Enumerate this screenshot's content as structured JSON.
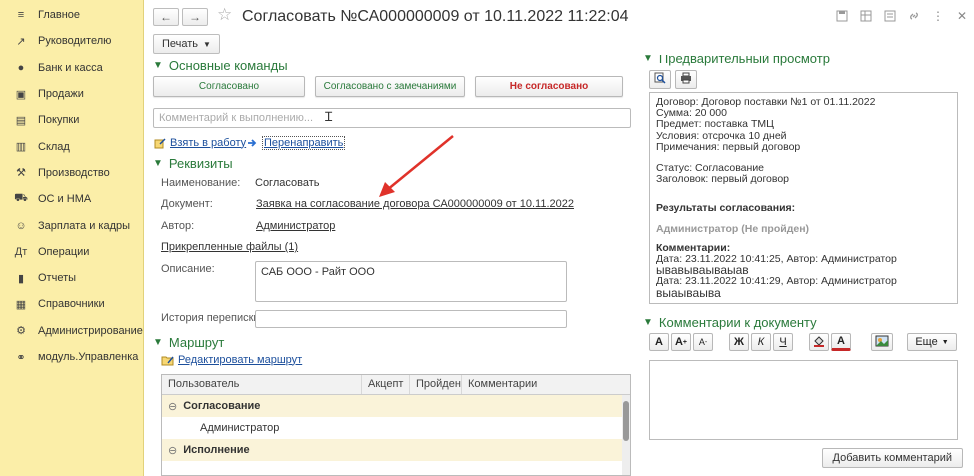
{
  "sidebar": {
    "items": [
      {
        "label": "Главное",
        "icon": "≡"
      },
      {
        "label": "Руководителю",
        "icon": "↗"
      },
      {
        "label": "Банк и касса",
        "icon": "●"
      },
      {
        "label": "Продажи",
        "icon": "▣"
      },
      {
        "label": "Покупки",
        "icon": "▤"
      },
      {
        "label": "Склад",
        "icon": "▥"
      },
      {
        "label": "Производство",
        "icon": "⚒"
      },
      {
        "label": "ОС и НМА",
        "icon": "⛟"
      },
      {
        "label": "Зарплата и кадры",
        "icon": "☺"
      },
      {
        "label": "Операции",
        "icon": "Дт"
      },
      {
        "label": "Отчеты",
        "icon": "▮"
      },
      {
        "label": "Справочники",
        "icon": "▦"
      },
      {
        "label": "Администрирование",
        "icon": "⚙"
      },
      {
        "label": "модуль.Управленка",
        "icon": "⚭"
      }
    ]
  },
  "header": {
    "title": "Согласовать №СА000000009 от 10.11.2022 11:22:04",
    "back_icon": "←",
    "forward_icon": "→",
    "star_icon": "☆"
  },
  "toolbar": {
    "print_label": "Печать"
  },
  "commands": {
    "section_title": "Основные команды",
    "approved": "Согласовано",
    "approved_remarks": "Согласовано с замечаниями",
    "rejected": "Не согласовано",
    "comment_placeholder": "Комментарий к выполнению...",
    "take_to_work": "Взять в работу",
    "redirect": "Перенаправить"
  },
  "details": {
    "section_title": "Реквизиты",
    "name_label": "Наименование:",
    "name_value": "Согласовать",
    "document_label": "Документ:",
    "document_value": "Заявка на согласование договора СА000000009 от 10.11.2022",
    "author_label": "Автор:",
    "author_value": "Администратор",
    "attached_files": "Прикрепленные файлы (1)",
    "description_label": "Описание:",
    "description_value": "САБ ООО - Райт ООО",
    "history_label": "История переписки:"
  },
  "route": {
    "section_title": "Маршрут",
    "edit_link": "Редактировать маршрут",
    "columns": [
      "Пользователь",
      "Акцепт",
      "Пройден",
      "Комментарии"
    ],
    "rows": [
      {
        "type": "group",
        "text": "Согласование"
      },
      {
        "type": "item",
        "text": "Администратор"
      },
      {
        "type": "group",
        "text": "Исполнение"
      }
    ]
  },
  "preview": {
    "section_title": "Предварительный просмотр",
    "lines": [
      "Договор: Договор поставки №1 от 01.11.2022",
      "Сумма: 20 000",
      "Предмет: поставка ТМЦ",
      "Условия: отсрочка 10 дней",
      "Примечания: первый договор"
    ],
    "status_line": "Статус: Согласование",
    "subject_line": "Заголовок: первый договор",
    "results_title": "Результаты согласования:",
    "results_user": "Администратор (Не пройден)",
    "comments_title": "Комментарии:",
    "comments": [
      {
        "meta": "Дата: 23.11.2022 10:41:25, Автор: Администратор",
        "text": "ывавываываыав"
      },
      {
        "meta": "Дата: 23.11.2022 10:41:29, Автор: Администратор",
        "text": "выаываыва"
      }
    ]
  },
  "doc_comments": {
    "section_title": "Комментарии к документу",
    "more_label": "Еще",
    "add_button": "Добавить комментарий"
  }
}
